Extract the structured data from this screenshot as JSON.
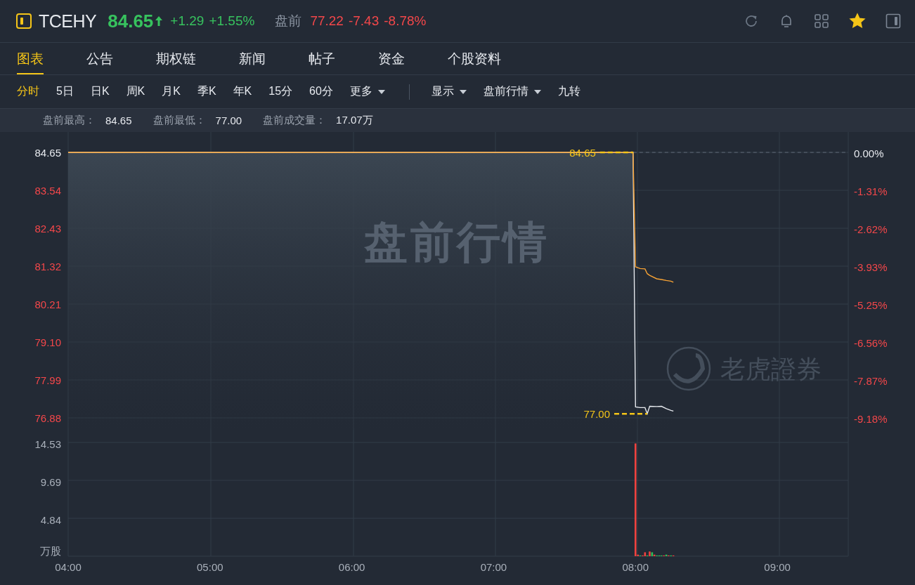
{
  "header": {
    "symbol": "TCEHY",
    "price": "84.65",
    "change": "+1.29",
    "change_pct": "+1.55%",
    "rising": true,
    "favorited": true,
    "session": {
      "label": "盘前",
      "price": "77.22",
      "change": "-7.43",
      "change_pct": "-8.78%",
      "rising": false
    }
  },
  "tabs": [
    {
      "label": "图表",
      "selected": true
    },
    {
      "label": "公告",
      "selected": false
    },
    {
      "label": "期权链",
      "selected": false
    },
    {
      "label": "新闻",
      "selected": false
    },
    {
      "label": "帖子",
      "selected": false
    },
    {
      "label": "资金",
      "selected": false
    },
    {
      "label": "个股资料",
      "selected": false
    }
  ],
  "periods": [
    {
      "label": "分时",
      "selected": true,
      "kind": "option"
    },
    {
      "label": "5日",
      "selected": false,
      "kind": "option"
    },
    {
      "label": "日K",
      "selected": false,
      "kind": "option"
    },
    {
      "label": "周K",
      "selected": false,
      "kind": "option"
    },
    {
      "label": "月K",
      "selected": false,
      "kind": "option"
    },
    {
      "label": "季K",
      "selected": false,
      "kind": "option"
    },
    {
      "label": "年K",
      "selected": false,
      "kind": "option"
    },
    {
      "label": "15分",
      "selected": false,
      "kind": "option"
    },
    {
      "label": "60分",
      "selected": false,
      "kind": "option"
    },
    {
      "label": "更多",
      "selected": false,
      "kind": "menu"
    }
  ],
  "display_controls": [
    {
      "label": "显示",
      "kind": "menu"
    },
    {
      "label": "盘前行情",
      "kind": "menu"
    },
    {
      "label": "九转",
      "kind": "option"
    }
  ],
  "stats": [
    {
      "label": "盘前最高：",
      "value": "84.65"
    },
    {
      "label": "盘前最低：",
      "value": "77.00"
    },
    {
      "label": "盘前成交量：",
      "value": "17.07万"
    }
  ],
  "price_chart": {
    "watermark": "盘前行情",
    "brand": "老虎證券",
    "percent_labels": [
      "0.00%",
      "-1.31%",
      "-2.62%",
      "-3.93%",
      "-5.25%",
      "-6.56%",
      "-7.87%",
      "-9.18%"
    ],
    "chart_data": {
      "type": "area",
      "grid": true,
      "x": [
        4,
        7.983,
        8,
        8.033,
        8.067,
        8.083,
        8.1,
        8.15,
        8.183,
        8.217,
        8.25,
        8.267
      ],
      "xlim": [
        4,
        9.5
      ],
      "ylim": [
        76.88,
        84.65
      ],
      "yticks": [
        84.65,
        83.54,
        82.43,
        81.32,
        80.21,
        {
          "value": 79.1,
          "label": "79.10"
        },
        77.99,
        76.88
      ],
      "series": [
        {
          "color": "#e6e9ee",
          "values": [
            84.65,
            84.65,
            77.2,
            77.18,
            77.18,
            77.0,
            77.22,
            77.21,
            77.22,
            77.15,
            77.1,
            77.08
          ]
        },
        {
          "type": "line",
          "color": "#f7a234",
          "values": [
            84.65,
            84.65,
            81.3,
            81.25,
            81.24,
            81.1,
            81.05,
            80.95,
            80.93,
            80.9,
            80.88,
            80.85
          ]
        }
      ],
      "annotations": [
        "84.65",
        "77.00"
      ]
    }
  },
  "volume_chart": {
    "chart_data": {
      "type": "bar",
      "stacked": true,
      "grid": true,
      "x": [
        8,
        8.017,
        8.033,
        8.05,
        8.067,
        8.083,
        8.1,
        8.117,
        8.133,
        8.15,
        8.167,
        8.183,
        8.2,
        8.217,
        8.233,
        8.25,
        8.267
      ],
      "xlim": [
        4,
        9.5
      ],
      "ylim": [
        0,
        14.53
      ],
      "yticks": [
        {
          "value": 0,
          "label": "万股"
        },
        4.84,
        9.69,
        14.53
      ],
      "xticks": [
        {
          "value": 4,
          "label": "04:00"
        },
        {
          "value": 5,
          "label": "05:00"
        },
        {
          "value": 6,
          "label": "06:00"
        },
        {
          "value": 7,
          "label": "07:00"
        },
        {
          "value": 8,
          "label": "08:00"
        },
        {
          "value": 9,
          "label": "09:00"
        }
      ],
      "series": [
        {
          "color": "#f0423f",
          "values": [
            14.4,
            0.2,
            null,
            0.1,
            0.5,
            null,
            0.6,
            null,
            0.2,
            null,
            null,
            null,
            0.1,
            null,
            0.1,
            null,
            0.1
          ]
        },
        {
          "color": "#2fc15a",
          "values": [
            null,
            null,
            0.1,
            null,
            null,
            0.1,
            null,
            0.5,
            null,
            0.1,
            0.1,
            0.1,
            null,
            0.2,
            null,
            0.1,
            null
          ]
        }
      ]
    }
  }
}
